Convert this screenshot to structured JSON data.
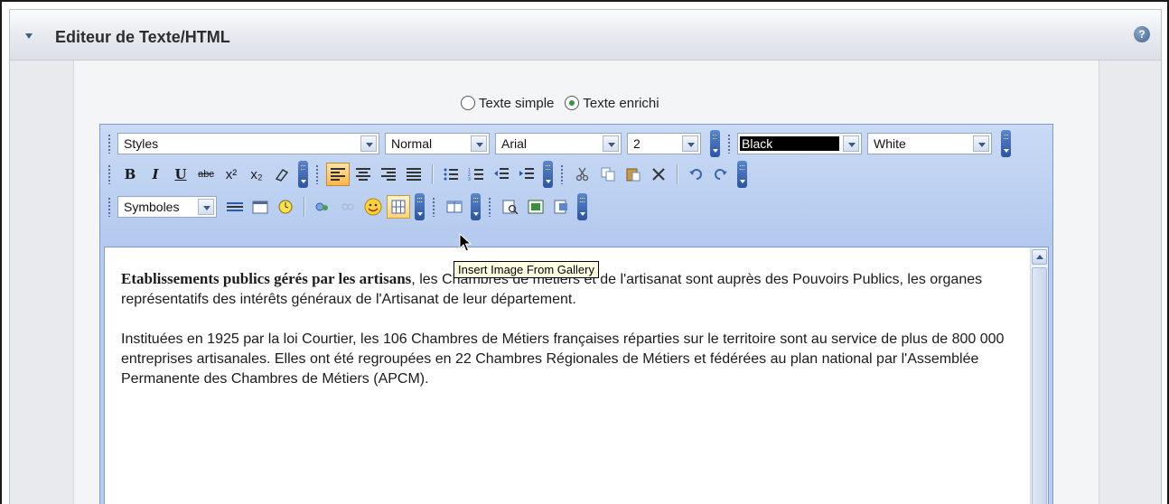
{
  "panel": {
    "title": "Editeur de Texte/HTML",
    "help_icon": "question-icon"
  },
  "mode": {
    "options": [
      {
        "label": "Texte simple",
        "checked": false
      },
      {
        "label": "Texte enrichi",
        "checked": true
      }
    ]
  },
  "toolbar": {
    "row1": {
      "style_select": "Styles",
      "format_select": "Normal",
      "font_select": "Arial",
      "size_select": "2",
      "forecolor_select": "Black",
      "backcolor_select": "White"
    },
    "row2": {
      "bold": "B",
      "italic": "I",
      "underline": "U",
      "strikethrough": "abc",
      "superscript": "x²",
      "subscript": "x₂"
    },
    "row3": {
      "symbols_select": "Symboles"
    }
  },
  "tooltip": "Insert Image From Gallery",
  "content": {
    "p1_bold": "Etablissements publics gérés par les artisans",
    "p1_rest": ", les Chambres de métiers et de l'artisanat sont auprès des Pouvoirs Publics, les organes représentatifs des intérêts généraux de l'Artisanat de leur département.",
    "p2": "Instituées en 1925 par la loi Courtier, les 106 Chambres de Métiers françaises réparties sur le territoire sont au service de plus de 800 000 entreprises artisanales. Elles ont été regroupées en 22 Chambres Régionales de Métiers et fédérées au plan national par l'Assemblée Permanente des Chambres de Métiers (APCM)."
  },
  "colors": {
    "toolbar_bg": "#b8cdee",
    "active_button": "#ffb64a",
    "accent_blue": "#3d5f8e"
  }
}
